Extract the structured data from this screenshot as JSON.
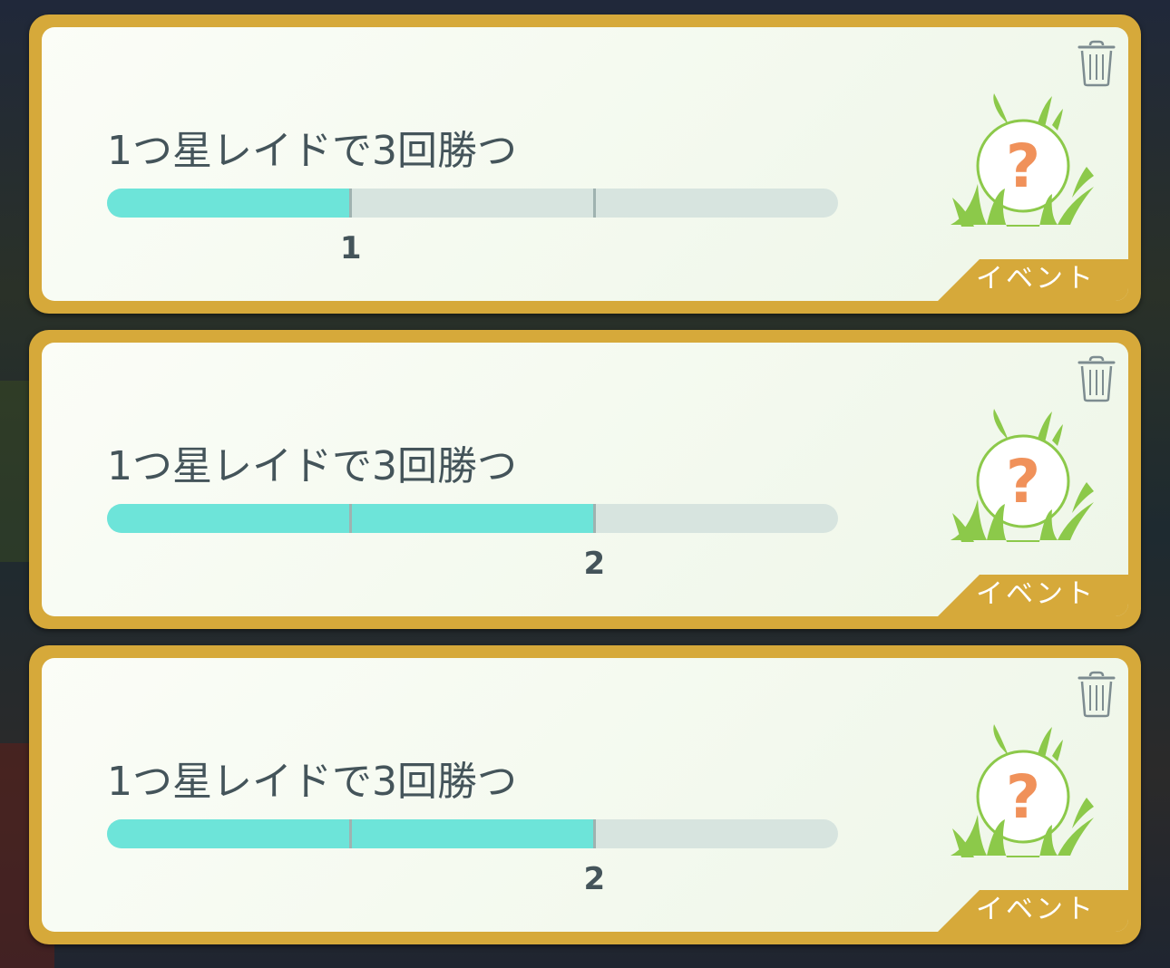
{
  "quests": [
    {
      "title": "1つ星レイドで3回勝つ",
      "progress": 1,
      "goal": 3,
      "progress_label": "1",
      "tag": "イベント",
      "reward_icon": "mystery-encounter-icon",
      "delete_icon": "trash-icon"
    },
    {
      "title": "1つ星レイドで3回勝つ",
      "progress": 2,
      "goal": 3,
      "progress_label": "2",
      "tag": "イベント",
      "reward_icon": "mystery-encounter-icon",
      "delete_icon": "trash-icon"
    },
    {
      "title": "1つ星レイドで3回勝つ",
      "progress": 2,
      "goal": 3,
      "progress_label": "2",
      "tag": "イベント",
      "reward_icon": "mystery-encounter-icon",
      "delete_icon": "trash-icon"
    }
  ],
  "colors": {
    "card_border": "#d6a93a",
    "bar_fill": "#6de4d9",
    "bar_track": "#d7e4df",
    "text": "#44545a",
    "question_mark": "#f0915a",
    "grass": "#8cc94a"
  }
}
